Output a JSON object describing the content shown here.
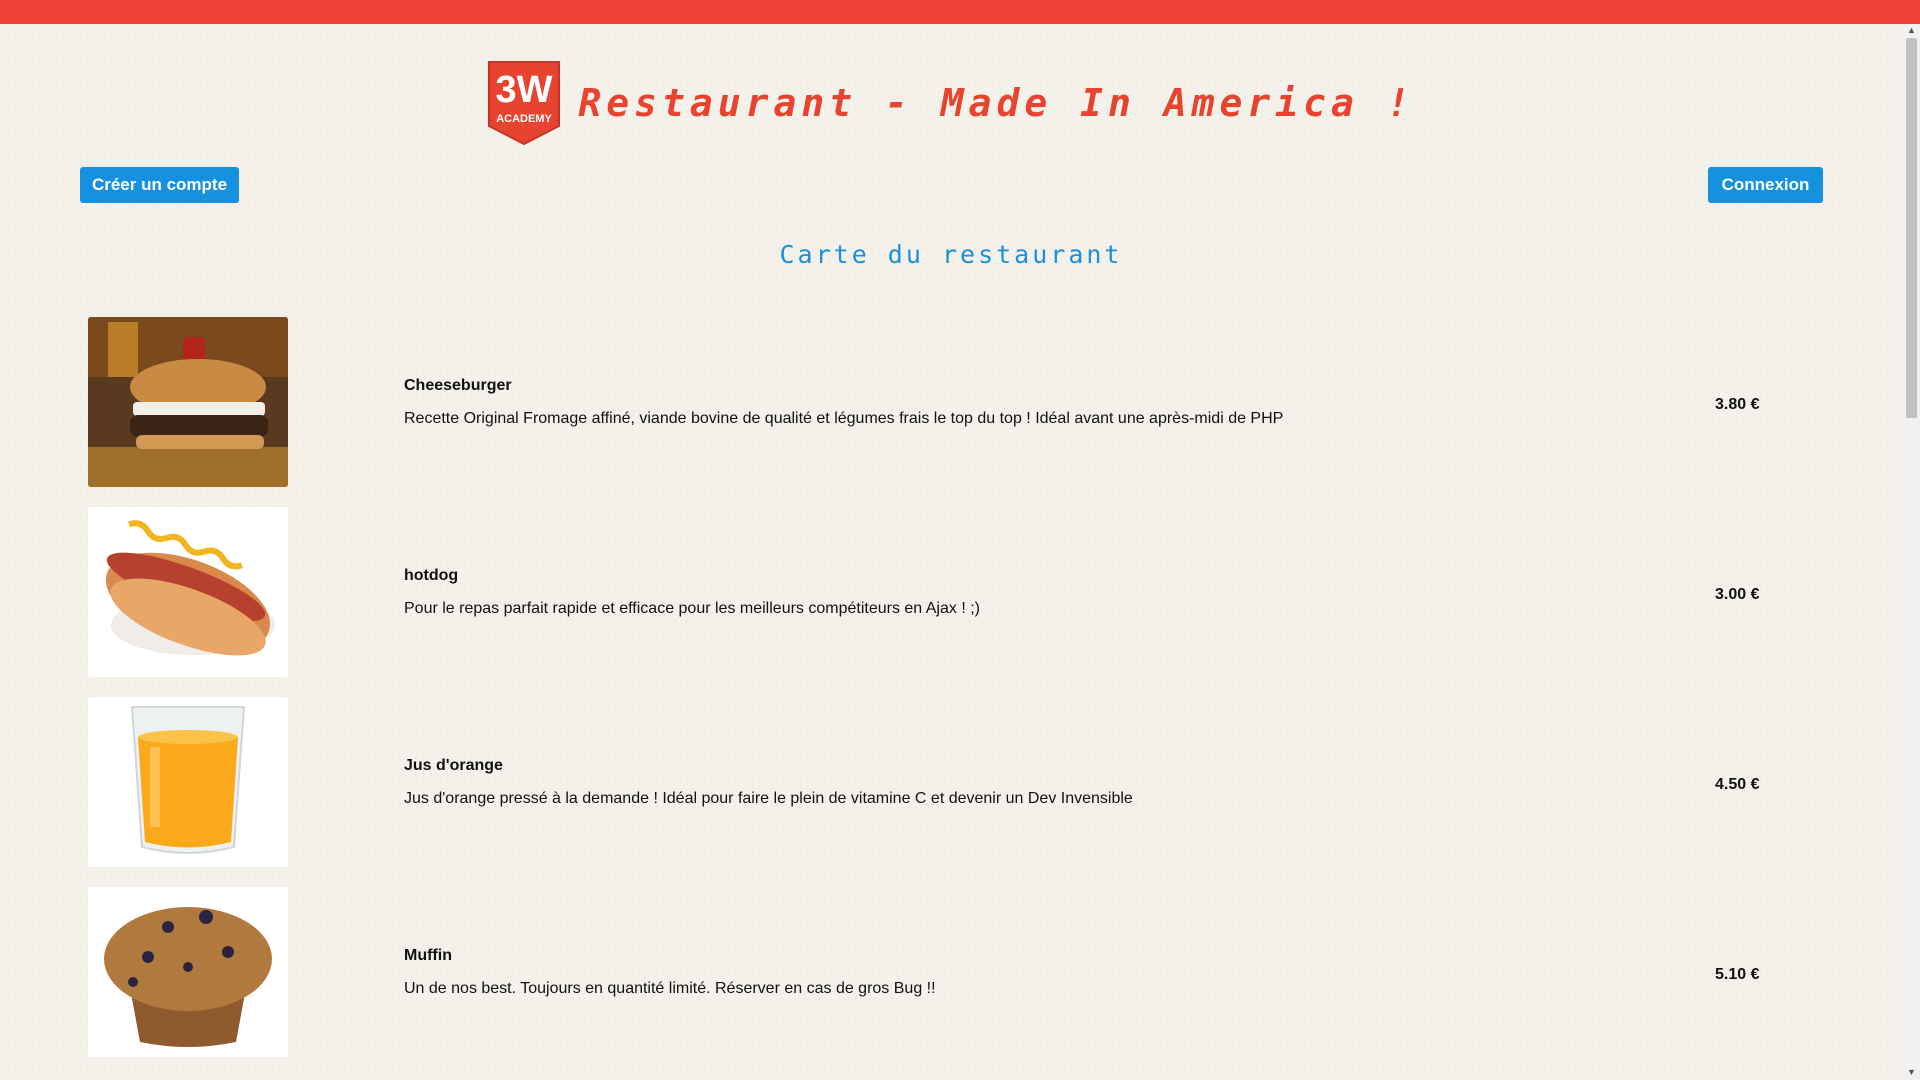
{
  "header": {
    "logo_text_top": "3W",
    "logo_text_bottom": "ACADEMY",
    "title": "Restaurant - Made In America !"
  },
  "buttons": {
    "create_account": "Créer un compte",
    "login": "Connexion"
  },
  "section_title": "Carte du restaurant",
  "menu": [
    {
      "name": "Cheeseburger",
      "description": "Recette Original Fromage affiné, viande bovine de qualité et légumes frais le top du top ! Idéal avant une après-midi de PHP",
      "price": "3.80 €",
      "image": "cheeseburger-image"
    },
    {
      "name": "hotdog",
      "description": "Pour le repas parfait rapide et efficace pour les meilleurs compétiteurs en Ajax ! ;)",
      "price": "3.00 €",
      "image": "hotdog-image"
    },
    {
      "name": "Jus d'orange",
      "description": "Jus d'orange pressé à la demande ! Idéal pour faire le plein de vitamine C et devenir un Dev Invensible",
      "price": "4.50 €",
      "image": "orange-juice-image"
    },
    {
      "name": "Muffin",
      "description": "Un de nos best. Toujours en quantité limité. Réserver en cas de gros Bug !!",
      "price": "5.10 €",
      "image": "muffin-image"
    }
  ],
  "colors": {
    "top_bar": "#ee4137",
    "title": "#e8432f",
    "button": "#1591e0",
    "section_title": "#1a8fdc",
    "background": "#f4f1ea"
  }
}
